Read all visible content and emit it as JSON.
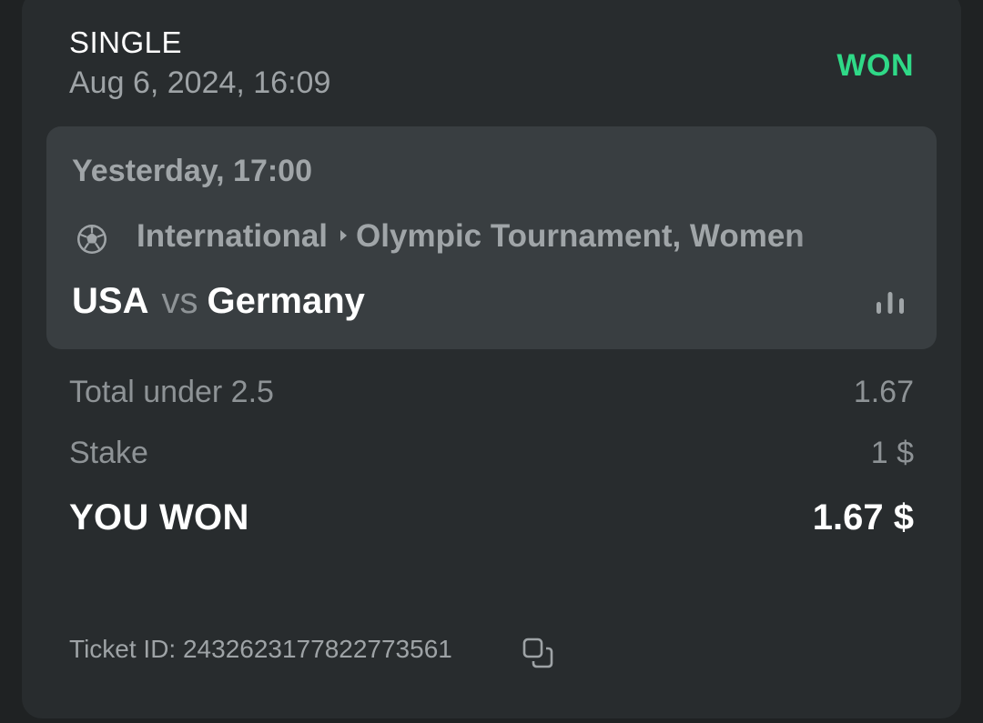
{
  "bet": {
    "type": "SINGLE",
    "placed_at": "Aug 6, 2024, 16:09",
    "status": "WON",
    "status_color": "#2fd987"
  },
  "event": {
    "time": "Yesterday, 17:00",
    "sport_icon": "soccer-ball-icon",
    "category": "International",
    "tournament": "Olympic Tournament, Women",
    "home_team": "USA",
    "vs": "vs",
    "away_team": "Germany",
    "stats_icon": "bar-chart-icon"
  },
  "selection": {
    "label": "Total under 2.5",
    "odds": "1.67"
  },
  "stake": {
    "label": "Stake",
    "value": "1 $"
  },
  "payout": {
    "label": "YOU WON",
    "value": "1.67 $"
  },
  "ticket": {
    "label": "Ticket ID: 243262317782277356​1",
    "id_text": "Ticket ID: 2432623177822773561",
    "copy_icon": "copy-icon"
  }
}
